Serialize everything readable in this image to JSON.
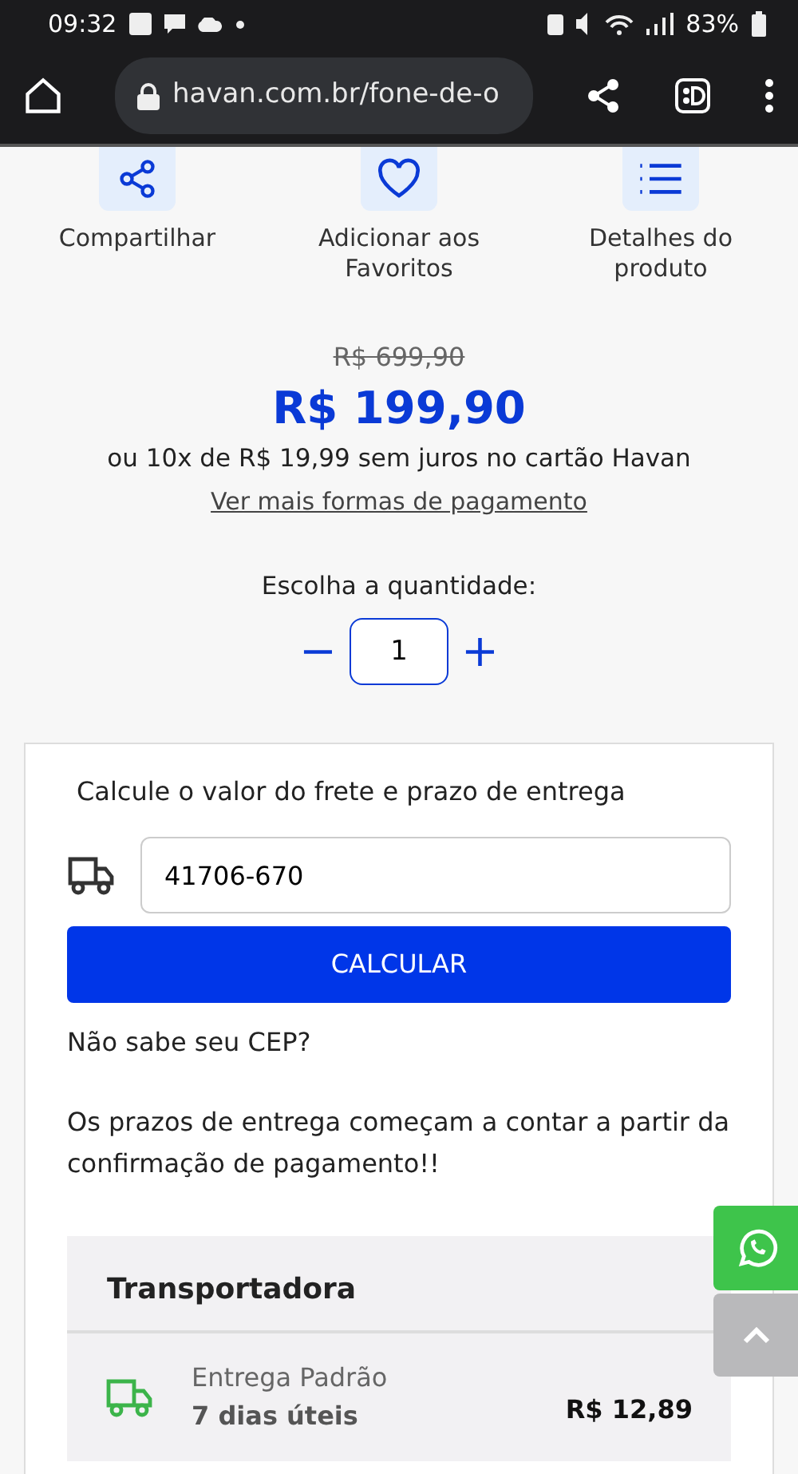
{
  "status_bar": {
    "time": "09:32",
    "battery": "83%"
  },
  "browser": {
    "url": "havan.com.br/fone-de-o"
  },
  "actions": [
    {
      "kind": "share",
      "label": "Compartilhar"
    },
    {
      "kind": "favorite",
      "label": "Adicionar aos Favoritos"
    },
    {
      "kind": "details",
      "label": "Detalhes do produto"
    }
  ],
  "price": {
    "old": "R$ 699,90",
    "current": "R$ 199,90",
    "installments": "ou 10x de R$ 19,99 sem juros no cartão Havan",
    "more_link": "Ver mais formas de pagamento"
  },
  "quantity": {
    "label": "Escolha a quantidade:",
    "minus": "−",
    "value": "1",
    "plus": "+"
  },
  "shipping": {
    "title": "Calcule o valor do frete e prazo de entrega",
    "cep": "41706-670",
    "button": "CALCULAR",
    "help": "Não sabe seu CEP?",
    "note": "Os prazos de entrega começam a contar a partir da confirmação de pagamento!!",
    "carrier_header": "Transportadora",
    "options": [
      {
        "name": "Entrega Padrão",
        "time": "7 dias úteis",
        "price": "R$ 12,89"
      }
    ]
  }
}
